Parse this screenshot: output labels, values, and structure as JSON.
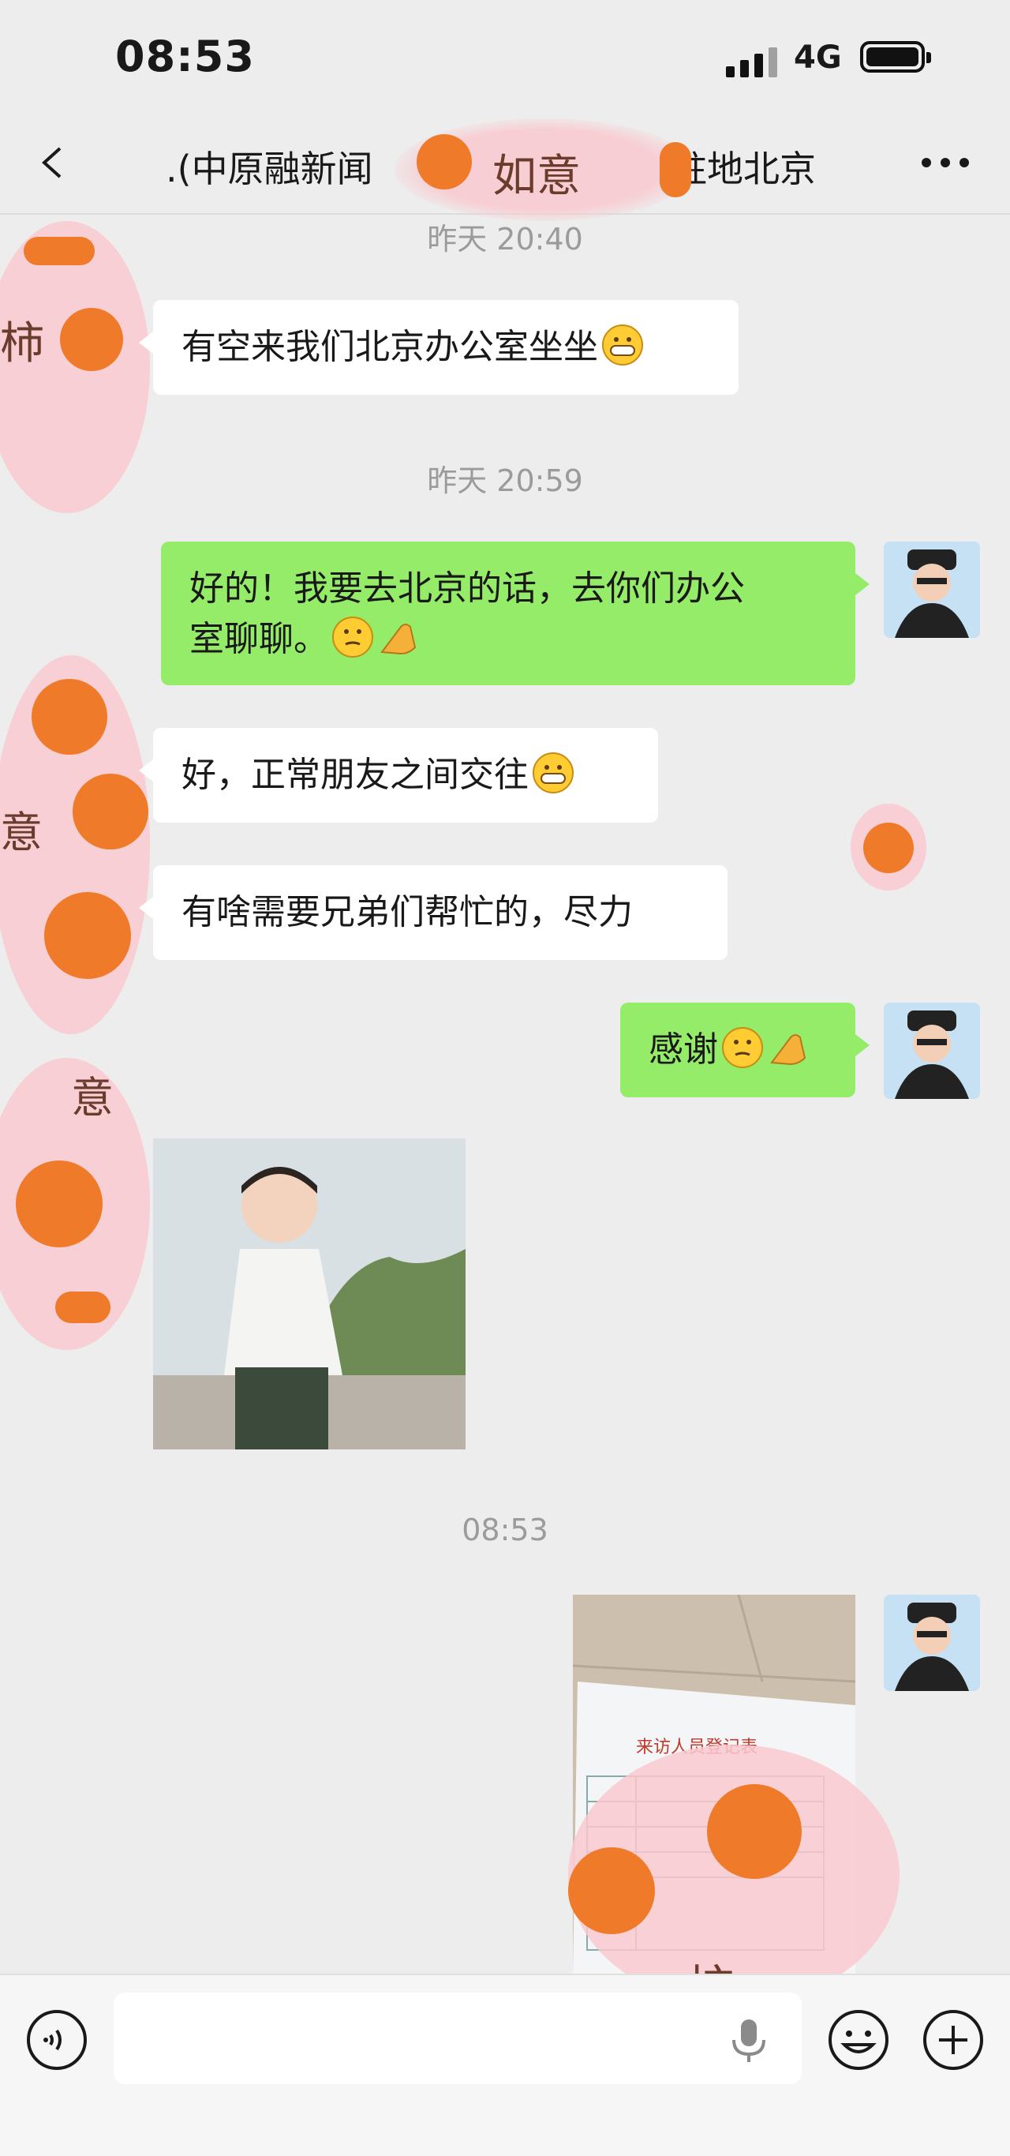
{
  "status_bar": {
    "time": "08:53",
    "network": "4G"
  },
  "nav": {
    "title_left": ".(中原融新闻",
    "title_right": "驻地北京"
  },
  "messages": {
    "ts1": "昨天 20:40",
    "m1": "有空来我们北京办公室坐坐",
    "ts2": "昨天 20:59",
    "m2_line1": "好的！我要去北京的话，去你们办公",
    "m2_line2": "室聊聊。",
    "m3": "好，正常朋友之间交往",
    "m4": "有啥需要兄弟们帮忙的，尽力",
    "m5": "感谢",
    "ts3": "08:53",
    "doc_caption": "来访人员登记表"
  },
  "sticker_text": {
    "top": "如意",
    "left_a": "柿",
    "left_b": "意",
    "left_c": "意",
    "bottom": "柿"
  },
  "input": {
    "placeholder": ""
  },
  "colors": {
    "bubble_out": "#95ec69",
    "bubble_in": "#ffffff",
    "bg": "#ededed"
  }
}
